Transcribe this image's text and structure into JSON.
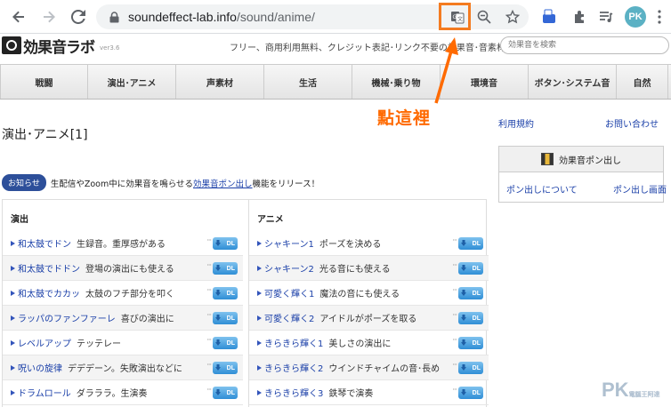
{
  "browser": {
    "url_domain": "soundeffect-lab.info",
    "url_path": "/sound/anime/",
    "avatar_initials": "PK"
  },
  "site": {
    "logo_text": "効果音ラボ",
    "logo_version": "ver3.6",
    "tagline": "フリー、商用利用無料、クレジット表記･リンク不要の効果音･音素材をダウンロ",
    "search_placeholder": "効果音を検索",
    "categories": [
      "戦闘",
      "演出･アニメ",
      "声素材",
      "生活",
      "機械･乗り物",
      "環境音",
      "ボタン･システム音",
      "自然"
    ]
  },
  "annotation": {
    "text": "點這裡",
    "color": "#ff6a00"
  },
  "page": {
    "title": "演出･アニメ[1]",
    "notice_badge": "お知らせ",
    "notice_before": "生配信やZoom中に効果音を鳴らせる",
    "notice_link": "効果音ポン出し",
    "notice_after": "機能をリリース！"
  },
  "sidebar": {
    "terms": "利用規約",
    "contact": "お問い合わせ",
    "pon_title": "効果音ポン出し",
    "pon_about": "ポン出しについて",
    "pon_screen": "ポン出し画面"
  },
  "lists": {
    "dl_label": "DL",
    "col1": {
      "heading": "演出",
      "items": [
        {
          "name": "和太鼓でドン",
          "desc": "生録音。重厚感がある"
        },
        {
          "name": "和太鼓でドドン",
          "desc": "登場の演出にも使える"
        },
        {
          "name": "和太鼓でカカッ",
          "desc": "太鼓のフチ部分を叩く"
        },
        {
          "name": "ラッパのファンファーレ",
          "desc": "喜びの演出に"
        },
        {
          "name": "レベルアップ",
          "desc": "テッテレー"
        },
        {
          "name": "呪いの旋律",
          "desc": "デデデーン。失敗演出などに"
        },
        {
          "name": "ドラムロール",
          "desc": "ダラララ。生演奏"
        }
      ]
    },
    "col2": {
      "heading": "アニメ",
      "items": [
        {
          "name": "シャキーン1",
          "desc": "ポーズを決める"
        },
        {
          "name": "シャキーン2",
          "desc": "光る音にも使える"
        },
        {
          "name": "可愛く輝く1",
          "desc": "魔法の音にも使える"
        },
        {
          "name": "可愛く輝く2",
          "desc": "アイドルがポーズを取る"
        },
        {
          "name": "きらきら輝く1",
          "desc": "美しさの演出に"
        },
        {
          "name": "きらきら輝く2",
          "desc": "ウインドチャイムの音･長め"
        },
        {
          "name": "きらきら輝く3",
          "desc": "鉄琴で演奏"
        }
      ]
    }
  },
  "watermark": {
    "main": "PK",
    "sub": "電腦王阿達"
  }
}
